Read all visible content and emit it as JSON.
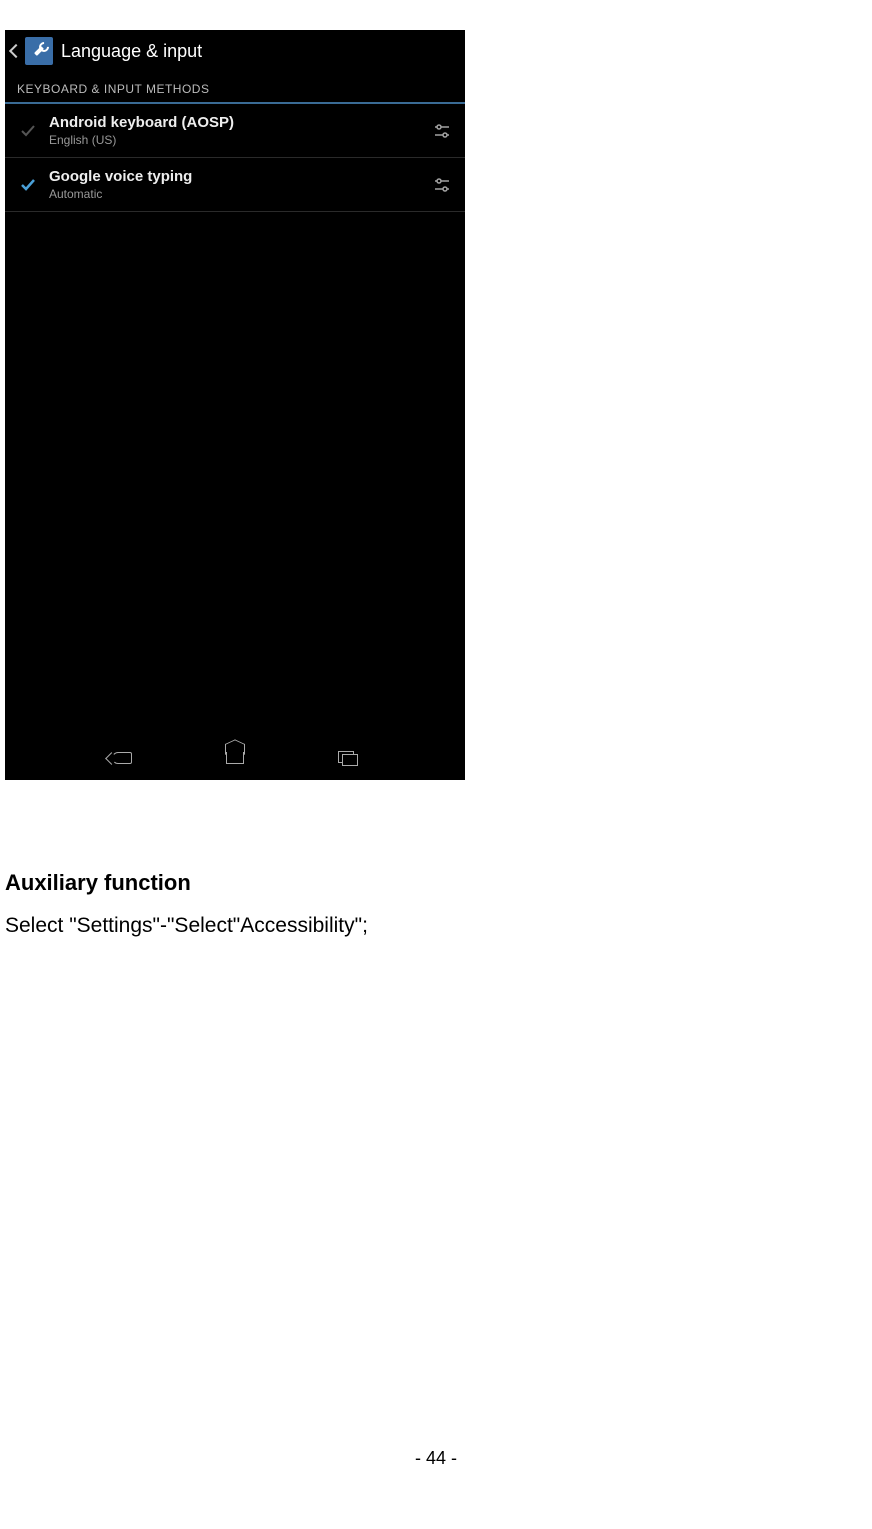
{
  "screenshot": {
    "title": "Language & input",
    "section_header": "KEYBOARD & INPUT METHODS",
    "items": [
      {
        "title": "Android keyboard (AOSP)",
        "subtitle": "English (US)",
        "checked": false
      },
      {
        "title": "Google voice typing",
        "subtitle": "Automatic",
        "checked": true
      }
    ]
  },
  "document": {
    "heading": "Auxiliary function",
    "body": "Select \"Settings\"-\"Select\"Accessibility\";",
    "page_number": "- 44 -"
  }
}
